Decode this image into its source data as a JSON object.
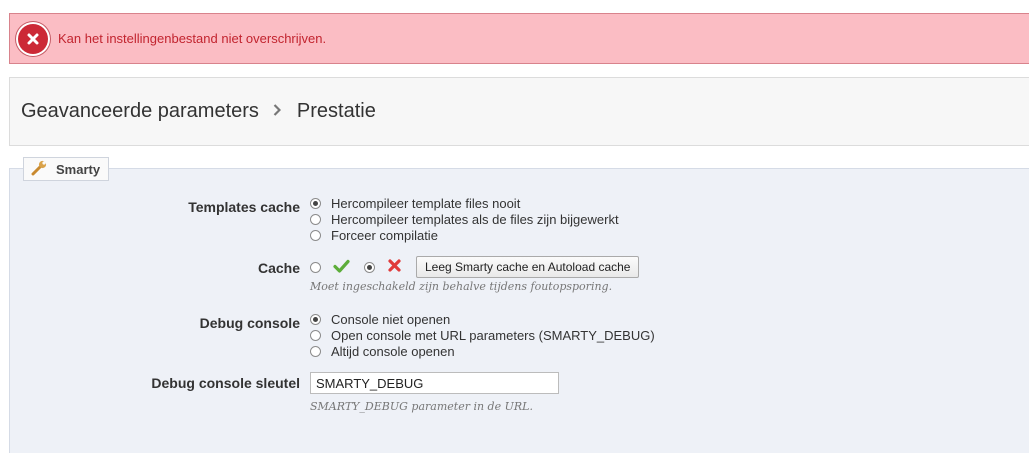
{
  "alert": {
    "message": "Kan het instellingenbestand niet overschrijven.",
    "color": "#c2242f",
    "icon": "close-circle-icon"
  },
  "breadcrumb": {
    "parent": "Geavanceerde parameters",
    "current": "Prestatie"
  },
  "panel": {
    "title": "Smarty",
    "icon": "wrench-icon"
  },
  "templates_cache": {
    "label": "Templates cache",
    "options": [
      {
        "label": "Hercompileer template files nooit",
        "checked": true
      },
      {
        "label": "Hercompileer templates als de files zijn bijgewerkt",
        "checked": false
      },
      {
        "label": "Forceer compilatie",
        "checked": false
      }
    ]
  },
  "cache": {
    "label": "Cache",
    "enabled_checked": false,
    "disabled_checked": true,
    "yes_icon": "check-icon",
    "no_icon": "cross-icon",
    "clear_button": "Leeg Smarty cache en Autoload cache",
    "hint": "Moet ingeschakeld zijn behalve tijdens foutopsporing."
  },
  "debug_console": {
    "label": "Debug console",
    "options": [
      {
        "label": "Console niet openen",
        "checked": true
      },
      {
        "label": "Open console met URL parameters (SMARTY_DEBUG)",
        "checked": false
      },
      {
        "label": "Altijd console openen",
        "checked": false
      }
    ]
  },
  "debug_key": {
    "label": "Debug console sleutel",
    "value": "SMARTY_DEBUG",
    "hint": "SMARTY_DEBUG parameter in de URL."
  }
}
